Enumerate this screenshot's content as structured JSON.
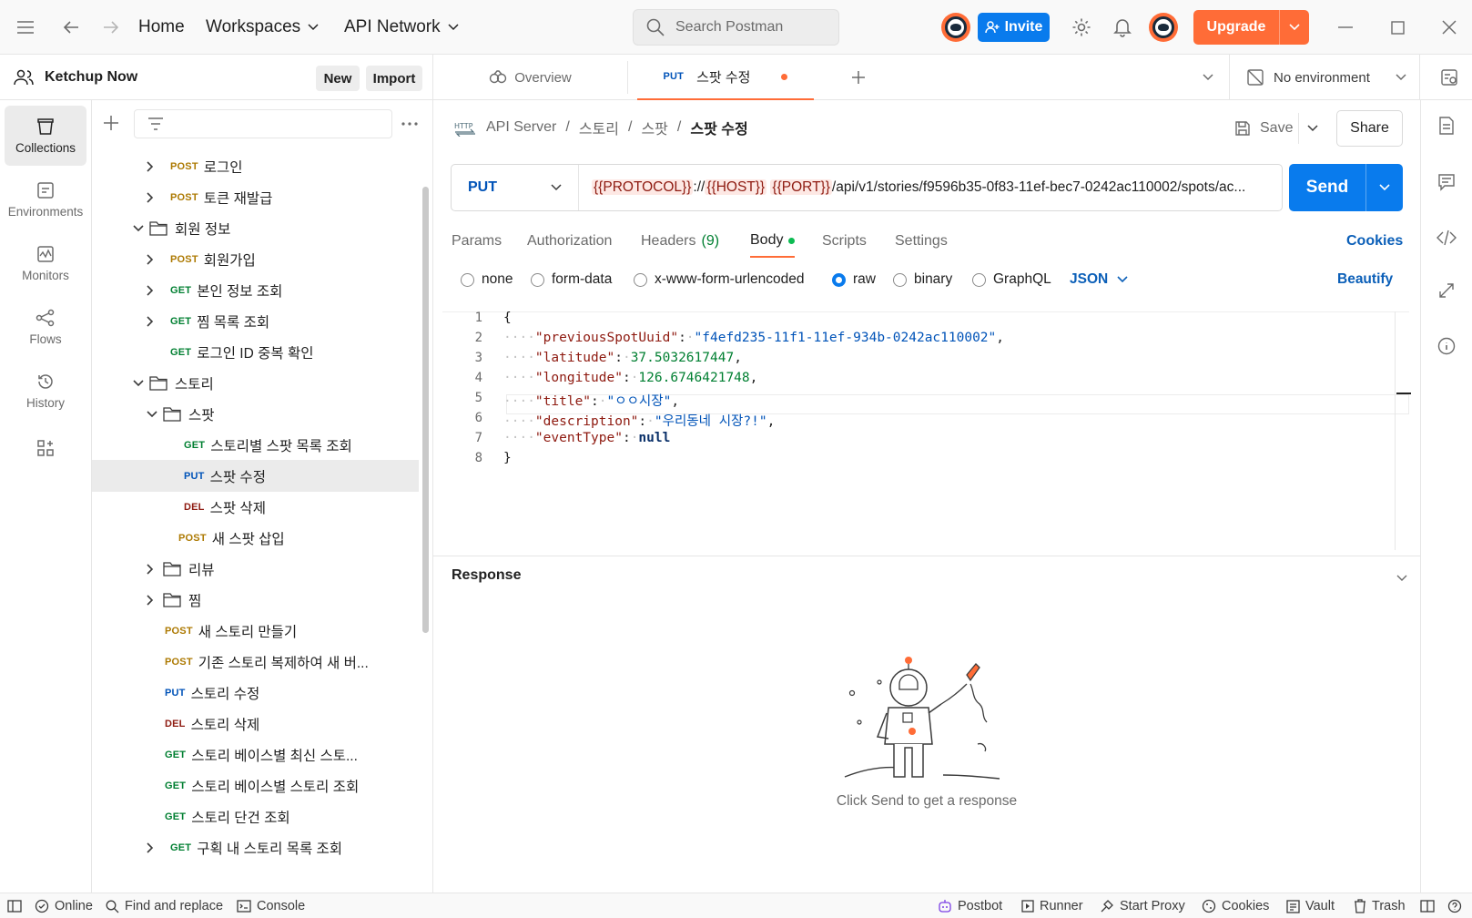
{
  "titlebar": {
    "home": "Home",
    "workspaces": "Workspaces",
    "api_network": "API Network",
    "search_placeholder": "Search Postman",
    "invite": "Invite",
    "upgrade": "Upgrade"
  },
  "workspace": {
    "name": "Ketchup Now",
    "new": "New",
    "import": "Import"
  },
  "rail": {
    "items": [
      {
        "label": "Collections",
        "icon": "collections-icon"
      },
      {
        "label": "Environments",
        "icon": "environments-icon"
      },
      {
        "label": "Monitors",
        "icon": "monitors-icon"
      },
      {
        "label": "Flows",
        "icon": "flows-icon"
      },
      {
        "label": "History",
        "icon": "history-icon"
      }
    ]
  },
  "tree": {
    "rows": [
      {
        "method": "POST",
        "label": "로그인"
      },
      {
        "method": "POST",
        "label": "토큰 재발급"
      },
      {
        "folder": true,
        "label": "회원 정보"
      },
      {
        "method": "POST",
        "label": "회원가입"
      },
      {
        "method": "GET",
        "label": "본인 정보 조회"
      },
      {
        "method": "GET",
        "label": "찜 목록 조회"
      },
      {
        "method": "GET",
        "label": "로그인 ID 중복 확인"
      },
      {
        "folder": true,
        "label": "스토리"
      },
      {
        "folder": true,
        "label": "스팟"
      },
      {
        "method": "GET",
        "label": "스토리별 스팟 목록 조회"
      },
      {
        "method": "PUT",
        "label": "스팟 수정"
      },
      {
        "method": "DEL",
        "label": "스팟 삭제"
      },
      {
        "method": "POST",
        "label": "새 스팟 삽입"
      },
      {
        "folder": true,
        "label": "리뷰"
      },
      {
        "folder": true,
        "label": "찜"
      },
      {
        "method": "POST",
        "label": "새 스토리 만들기"
      },
      {
        "method": "POST",
        "label": "기존 스토리 복제하여 새 버..."
      },
      {
        "method": "PUT",
        "label": "스토리 수정"
      },
      {
        "method": "DEL",
        "label": "스토리 삭제"
      },
      {
        "method": "GET",
        "label": "스토리 베이스별 최신 스토..."
      },
      {
        "method": "GET",
        "label": "스토리 베이스별 스토리 조회"
      },
      {
        "method": "GET",
        "label": "스토리 단건 조회"
      },
      {
        "method": "GET",
        "label": "구획 내 스토리 목록 조회"
      }
    ]
  },
  "tabs": {
    "overview": "Overview",
    "active_method": "PUT",
    "active_label": "스팟 수정",
    "environment": "No environment"
  },
  "request": {
    "breadcrumb": [
      "API Server",
      "스토리",
      "스팟",
      "스팟 수정"
    ],
    "save": "Save",
    "share": "Share",
    "method": "PUT",
    "url_vars": [
      "{{PROTOCOL}}",
      "{{HOST}}",
      "{{PORT}}"
    ],
    "url_sep": "://",
    "url_path": "/api/v1/stories/f9596b35-0f83-11ef-bec7-0242ac110002/spots/ac...",
    "send": "Send",
    "tabs": {
      "params": "Params",
      "authorization": "Authorization",
      "headers": "Headers",
      "headers_count": "(9)",
      "body": "Body",
      "scripts": "Scripts",
      "settings": "Settings",
      "cookies": "Cookies"
    },
    "body_types": [
      "none",
      "form-data",
      "x-www-form-urlencoded",
      "raw",
      "binary",
      "GraphQL"
    ],
    "body_format": "JSON",
    "beautify": "Beautify"
  },
  "editor": {
    "line_numbers": [
      "1",
      "2",
      "3",
      "4",
      "5",
      "6",
      "7",
      "8"
    ],
    "open_brace": "{",
    "close_brace": "}",
    "fields": [
      {
        "key": "\"previousSpotUuid\"",
        "value": "\"f4efd235-11f1-11ef-934b-0242ac110002\""
      },
      {
        "key": "\"latitude\"",
        "value": "37.5032617447"
      },
      {
        "key": "\"longitude\"",
        "value": "126.6746421748"
      },
      {
        "key": "\"title\"",
        "value": "\"ㅇㅇ시장\""
      },
      {
        "key": "\"description\"",
        "value": "\"우리동네 시장?!\""
      },
      {
        "key": "\"eventType\"",
        "value": "null"
      }
    ]
  },
  "response": {
    "title": "Response",
    "empty_message": "Click Send to get a response"
  },
  "statusbar": {
    "online": "Online",
    "find_replace": "Find and replace",
    "console": "Console",
    "postbot": "Postbot",
    "runner": "Runner",
    "start_proxy": "Start Proxy",
    "cookies": "Cookies",
    "vault": "Vault",
    "trash": "Trash"
  },
  "colors": {
    "accent": "#ff6c37",
    "primary": "#097bed",
    "get": "#007f31",
    "post": "#ad7a03",
    "put": "#0053b8",
    "delete": "#8e1a10"
  }
}
